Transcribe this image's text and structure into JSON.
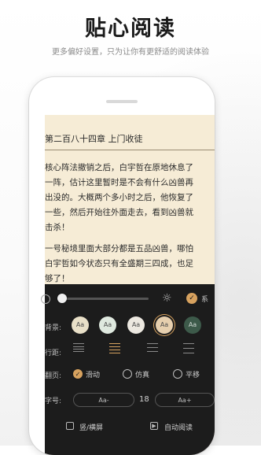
{
  "header": {
    "title": "贴心阅读",
    "subtitle": "更多偏好设置，只为让你有更舒适的阅读体验"
  },
  "reader": {
    "chapter_title": "第二百八十四章 上门收徒",
    "paragraphs": [
      "核心阵法撤销之后，白宇哲在原地休息了",
      "一阵，估计这里暂时是不会有什么凶兽再",
      "出没的。大概两个多小时之后，他恢复了",
      "一些，然后开始往外面走去，看到凶兽就",
      "击杀！",
      "一号秘境里面大部分都是五品凶兽，哪怕",
      "白宇哲如今状态只有全盛期三四成，也足",
      "够了！"
    ]
  },
  "settings": {
    "brightness": 0.05,
    "auto_brightness_label": "系",
    "background_label": "背景:",
    "background_swatch_text": "Aa",
    "background_colors": [
      "#e9e0c8",
      "#dfe9df",
      "#ece8e0",
      "#e6cfae",
      "#3d5a4a"
    ],
    "selected_background_index": 3,
    "line_spacing_label": "行距:",
    "page_turn_label": "翻页:",
    "page_turn_options": [
      "滑动",
      "仿真",
      "平移"
    ],
    "selected_page_turn_index": 0,
    "font_size_label": "字号:",
    "font_decrease_label": "Aa-",
    "font_size_value": "18",
    "font_increase_label": "Aa+",
    "orientation_label": "竖/横屏",
    "auto_read_label": "自动阅读",
    "accent_color": "#d7a25f",
    "panel_color": "#1c1c1c",
    "paper_color": "#f6ecd6"
  }
}
